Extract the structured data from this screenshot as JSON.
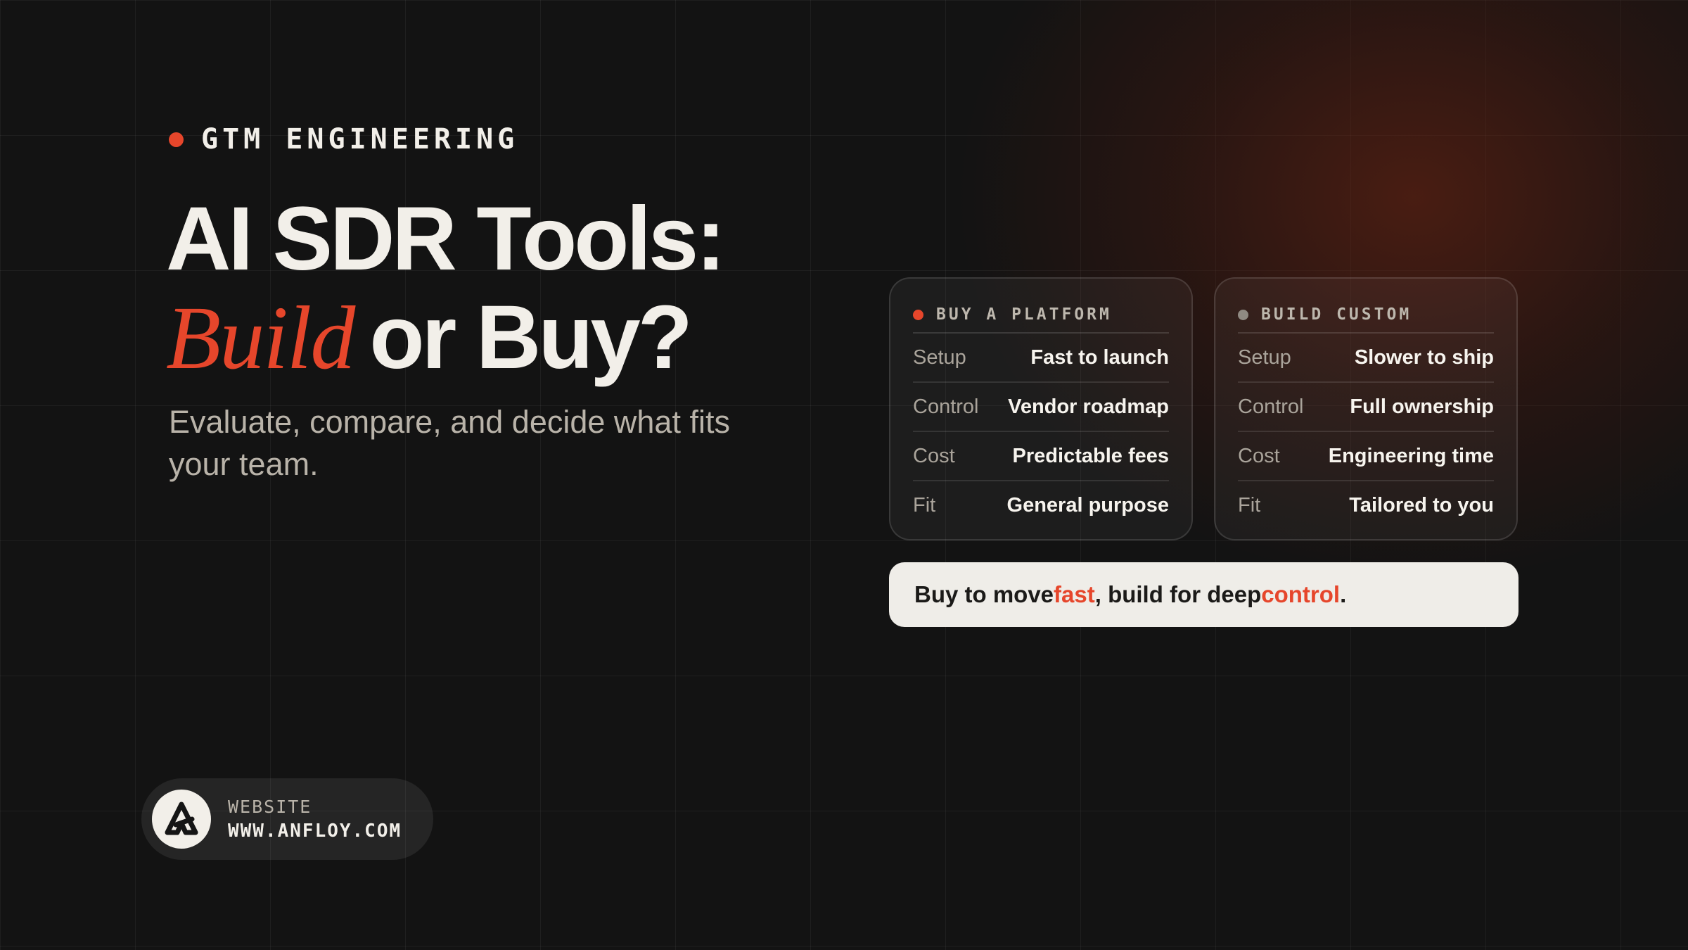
{
  "eyebrow": {
    "text": "GTM ENGINEERING"
  },
  "headline": {
    "line1": "AI SDR Tools:",
    "accent": "Build",
    "rest": "or Buy?"
  },
  "subtitle": "Evaluate, compare, and decide what fits your team.",
  "cards": [
    {
      "title": "BUY A PLATFORM",
      "rows": [
        {
          "label": "Setup",
          "value": "Fast to launch"
        },
        {
          "label": "Control",
          "value": "Vendor roadmap"
        },
        {
          "label": "Cost",
          "value": "Predictable fees"
        },
        {
          "label": "Fit",
          "value": "General purpose"
        }
      ]
    },
    {
      "title": "BUILD CUSTOM",
      "rows": [
        {
          "label": "Setup",
          "value": "Slower to ship"
        },
        {
          "label": "Control",
          "value": "Full ownership"
        },
        {
          "label": "Cost",
          "value": "Engineering time"
        },
        {
          "label": "Fit",
          "value": "Tailored to you"
        }
      ]
    }
  ],
  "verdict": {
    "prefix": "Buy to move ",
    "accent1": "fast",
    "middle": ", build for deep ",
    "accent2": "control",
    "suffix": "."
  },
  "website": {
    "label": "WEBSITE",
    "url": "WWW.ANFLOY.COM"
  },
  "colors": {
    "accent": "#e6462b",
    "background": "#131313",
    "text": "#f2efe9",
    "muted": "#b9b3a9",
    "verdict_bg": "#efede8"
  },
  "icons": {
    "eyebrow": "dot-icon",
    "logo": "anfloy-logo-icon"
  }
}
